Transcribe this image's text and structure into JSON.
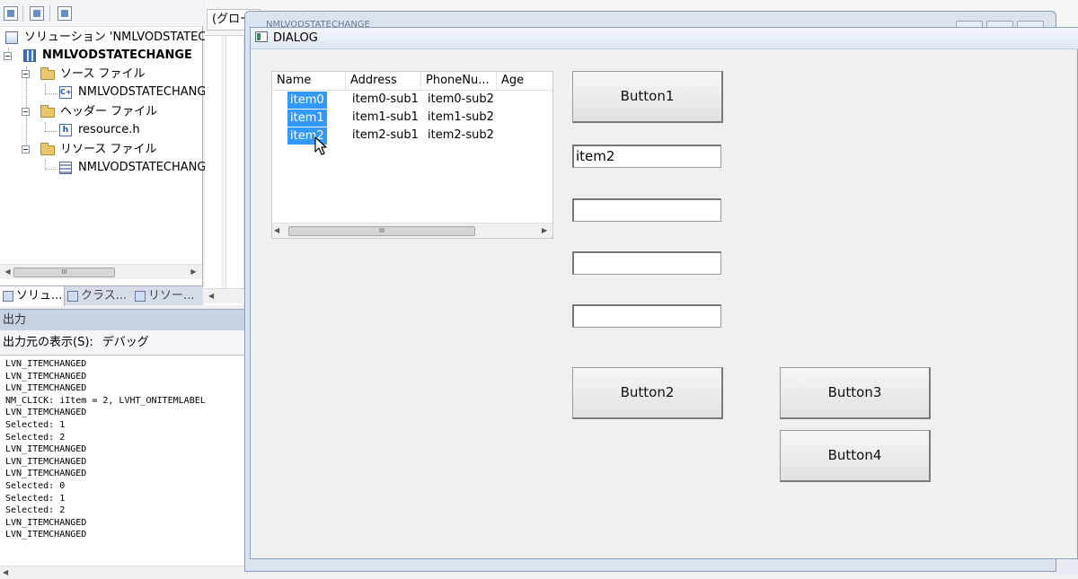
{
  "solution_explorer": {
    "items": [
      {
        "label": "ソリューション 'NMLVODSTATEC",
        "icon": "solution-icon"
      },
      {
        "label": "NMLVODSTATECHANGE",
        "icon": "project-icon"
      },
      {
        "label": "ソース ファイル",
        "icon": "folder-icon"
      },
      {
        "label": "NMLVODSTATECHANG",
        "icon": "cpp-file-icon"
      },
      {
        "label": "ヘッダー ファイル",
        "icon": "folder-icon"
      },
      {
        "label": "resource.h",
        "icon": "header-file-icon"
      },
      {
        "label": "リソース ファイル",
        "icon": "folder-icon"
      },
      {
        "label": "NMLVODSTATECHANG",
        "icon": "resource-file-icon"
      }
    ],
    "scroll_thumb": "III",
    "tabs": [
      "ソリュ...",
      "クラス...",
      "リソー..."
    ]
  },
  "editor": {
    "scope_combo": "(グロー"
  },
  "output": {
    "header": "出力",
    "source_label": "出力元の表示(S):",
    "source_value": "デバッグ",
    "lines": [
      "LVN_ITEMCHANGED",
      "LVN_ITEMCHANGED",
      "LVN_ITEMCHANGED",
      "NM_CLICK: iItem = 2, LVHT_ONITEMLABEL",
      "LVN_ITEMCHANGED",
      "Selected: 1",
      "Selected: 2",
      "LVN_ITEMCHANGED",
      "LVN_ITEMCHANGED",
      "LVN_ITEMCHANGED",
      "Selected: 0",
      "Selected: 1",
      "Selected: 2",
      "LVN_ITEMCHANGED",
      "LVN_ITEMCHANGED"
    ]
  },
  "frame_behind": {
    "title": "NMLVODSTATECHANGE"
  },
  "dialog": {
    "title": "DIALOG",
    "listview": {
      "columns": [
        "Name",
        "Address",
        "PhoneNu...",
        "Age"
      ],
      "rows": [
        [
          "item0",
          "item0-sub1",
          "item0-sub2"
        ],
        [
          "item1",
          "item1-sub1",
          "item1-sub2"
        ],
        [
          "item2",
          "item2-sub1",
          "item2-sub2"
        ]
      ],
      "scroll_thumb": "III"
    },
    "buttons": {
      "button1": "Button1",
      "button2": "Button2",
      "button3": "Button3",
      "button4": "Button4"
    },
    "edits": [
      "item2",
      "",
      "",
      ""
    ]
  },
  "colors": {
    "selection": "#3399ff",
    "dialog_bg": "#f0f0f0"
  }
}
